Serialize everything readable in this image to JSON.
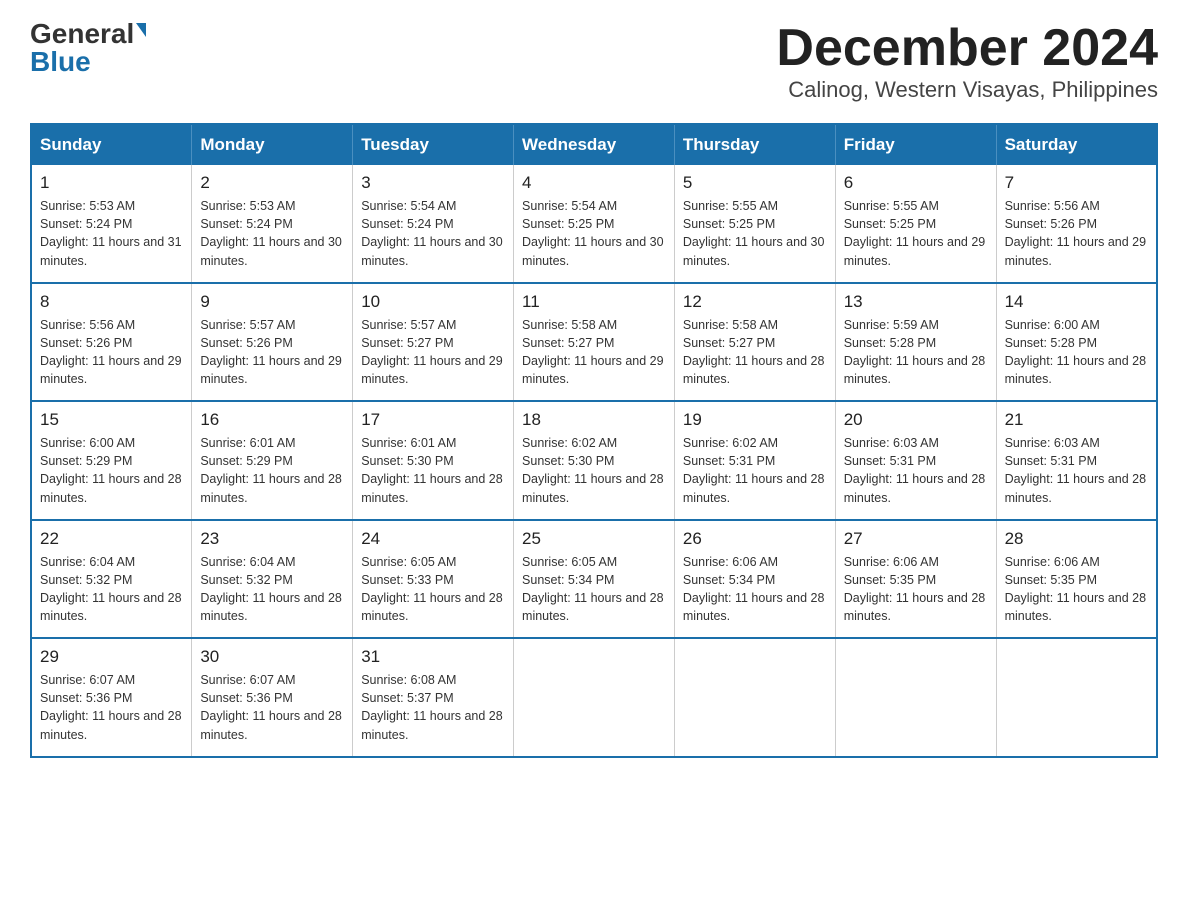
{
  "header": {
    "logo_general": "General",
    "logo_blue": "Blue",
    "month_title": "December 2024",
    "location": "Calinog, Western Visayas, Philippines"
  },
  "days_of_week": [
    "Sunday",
    "Monday",
    "Tuesday",
    "Wednesday",
    "Thursday",
    "Friday",
    "Saturday"
  ],
  "weeks": [
    [
      {
        "day": "1",
        "sunrise": "5:53 AM",
        "sunset": "5:24 PM",
        "daylight": "11 hours and 31 minutes."
      },
      {
        "day": "2",
        "sunrise": "5:53 AM",
        "sunset": "5:24 PM",
        "daylight": "11 hours and 30 minutes."
      },
      {
        "day": "3",
        "sunrise": "5:54 AM",
        "sunset": "5:24 PM",
        "daylight": "11 hours and 30 minutes."
      },
      {
        "day": "4",
        "sunrise": "5:54 AM",
        "sunset": "5:25 PM",
        "daylight": "11 hours and 30 minutes."
      },
      {
        "day": "5",
        "sunrise": "5:55 AM",
        "sunset": "5:25 PM",
        "daylight": "11 hours and 30 minutes."
      },
      {
        "day": "6",
        "sunrise": "5:55 AM",
        "sunset": "5:25 PM",
        "daylight": "11 hours and 29 minutes."
      },
      {
        "day": "7",
        "sunrise": "5:56 AM",
        "sunset": "5:26 PM",
        "daylight": "11 hours and 29 minutes."
      }
    ],
    [
      {
        "day": "8",
        "sunrise": "5:56 AM",
        "sunset": "5:26 PM",
        "daylight": "11 hours and 29 minutes."
      },
      {
        "day": "9",
        "sunrise": "5:57 AM",
        "sunset": "5:26 PM",
        "daylight": "11 hours and 29 minutes."
      },
      {
        "day": "10",
        "sunrise": "5:57 AM",
        "sunset": "5:27 PM",
        "daylight": "11 hours and 29 minutes."
      },
      {
        "day": "11",
        "sunrise": "5:58 AM",
        "sunset": "5:27 PM",
        "daylight": "11 hours and 29 minutes."
      },
      {
        "day": "12",
        "sunrise": "5:58 AM",
        "sunset": "5:27 PM",
        "daylight": "11 hours and 28 minutes."
      },
      {
        "day": "13",
        "sunrise": "5:59 AM",
        "sunset": "5:28 PM",
        "daylight": "11 hours and 28 minutes."
      },
      {
        "day": "14",
        "sunrise": "6:00 AM",
        "sunset": "5:28 PM",
        "daylight": "11 hours and 28 minutes."
      }
    ],
    [
      {
        "day": "15",
        "sunrise": "6:00 AM",
        "sunset": "5:29 PM",
        "daylight": "11 hours and 28 minutes."
      },
      {
        "day": "16",
        "sunrise": "6:01 AM",
        "sunset": "5:29 PM",
        "daylight": "11 hours and 28 minutes."
      },
      {
        "day": "17",
        "sunrise": "6:01 AM",
        "sunset": "5:30 PM",
        "daylight": "11 hours and 28 minutes."
      },
      {
        "day": "18",
        "sunrise": "6:02 AM",
        "sunset": "5:30 PM",
        "daylight": "11 hours and 28 minutes."
      },
      {
        "day": "19",
        "sunrise": "6:02 AM",
        "sunset": "5:31 PM",
        "daylight": "11 hours and 28 minutes."
      },
      {
        "day": "20",
        "sunrise": "6:03 AM",
        "sunset": "5:31 PM",
        "daylight": "11 hours and 28 minutes."
      },
      {
        "day": "21",
        "sunrise": "6:03 AM",
        "sunset": "5:31 PM",
        "daylight": "11 hours and 28 minutes."
      }
    ],
    [
      {
        "day": "22",
        "sunrise": "6:04 AM",
        "sunset": "5:32 PM",
        "daylight": "11 hours and 28 minutes."
      },
      {
        "day": "23",
        "sunrise": "6:04 AM",
        "sunset": "5:32 PM",
        "daylight": "11 hours and 28 minutes."
      },
      {
        "day": "24",
        "sunrise": "6:05 AM",
        "sunset": "5:33 PM",
        "daylight": "11 hours and 28 minutes."
      },
      {
        "day": "25",
        "sunrise": "6:05 AM",
        "sunset": "5:34 PM",
        "daylight": "11 hours and 28 minutes."
      },
      {
        "day": "26",
        "sunrise": "6:06 AM",
        "sunset": "5:34 PM",
        "daylight": "11 hours and 28 minutes."
      },
      {
        "day": "27",
        "sunrise": "6:06 AM",
        "sunset": "5:35 PM",
        "daylight": "11 hours and 28 minutes."
      },
      {
        "day": "28",
        "sunrise": "6:06 AM",
        "sunset": "5:35 PM",
        "daylight": "11 hours and 28 minutes."
      }
    ],
    [
      {
        "day": "29",
        "sunrise": "6:07 AM",
        "sunset": "5:36 PM",
        "daylight": "11 hours and 28 minutes."
      },
      {
        "day": "30",
        "sunrise": "6:07 AM",
        "sunset": "5:36 PM",
        "daylight": "11 hours and 28 minutes."
      },
      {
        "day": "31",
        "sunrise": "6:08 AM",
        "sunset": "5:37 PM",
        "daylight": "11 hours and 28 minutes."
      },
      null,
      null,
      null,
      null
    ]
  ]
}
